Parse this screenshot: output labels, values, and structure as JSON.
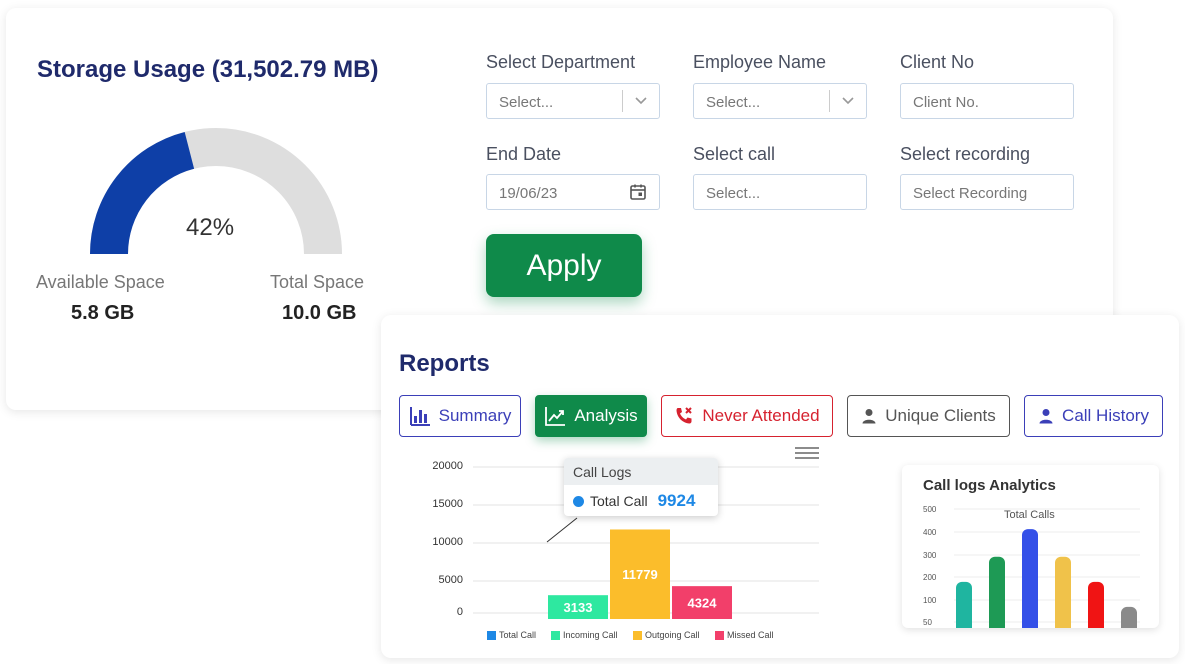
{
  "storage": {
    "title": "Storage Usage (31,502.79 MB)",
    "percent_label": "42%",
    "percent": 0.42,
    "available_label": "Available Space",
    "available_value": "5.8 GB",
    "total_label": "Total Space",
    "total_value": "10.0 GB",
    "used_color": "#0e3fa7",
    "track_color": "#dedede"
  },
  "filters": {
    "department": {
      "label": "Select Department",
      "placeholder": "Select..."
    },
    "employee": {
      "label": "Employee Name",
      "placeholder": "Select..."
    },
    "client": {
      "label": "Client No",
      "placeholder": "Client No."
    },
    "end_date": {
      "label": "End Date",
      "value": "19/06/23"
    },
    "call": {
      "label": "Select call",
      "placeholder": "Select..."
    },
    "recording": {
      "label": "Select recording",
      "placeholder": "Select Recording"
    },
    "apply_label": "Apply"
  },
  "reports": {
    "title": "Reports",
    "tabs": [
      {
        "label": "Summary",
        "icon": "bar-chart-icon"
      },
      {
        "label": "Analysis",
        "icon": "trend-icon"
      },
      {
        "label": "Never Attended",
        "icon": "missed-call-icon"
      },
      {
        "label": "Unique Clients",
        "icon": "user-icon"
      },
      {
        "label": "Call History",
        "icon": "user-icon"
      }
    ]
  },
  "chart_data": [
    {
      "type": "bar",
      "y_ticks": [
        "20000",
        "15000",
        "10000",
        "5000",
        "0"
      ],
      "ylim": [
        0,
        20000
      ],
      "series": [
        {
          "name": "Total Call",
          "value": 9924,
          "color": "#1e88e5"
        },
        {
          "name": "Incoming Call",
          "value": 3133,
          "color": "#2ee8a0"
        },
        {
          "name": "Outgoing Call",
          "value": 11779,
          "color": "#fbbd2b"
        },
        {
          "name": "Missed Call",
          "value": 4324,
          "color": "#f23f6a"
        }
      ],
      "tooltip": {
        "title": "Call Logs",
        "series": "Total Call",
        "value": "9924"
      }
    },
    {
      "type": "bar",
      "title": "Call logs Analytics",
      "subtitle": "Total Calls",
      "y_ticks": [
        "500",
        "400",
        "300",
        "200",
        "100",
        "50"
      ],
      "values": [
        210,
        310,
        420,
        310,
        210,
        110
      ],
      "colors": [
        "#1fb5a0",
        "#1e9a55",
        "#3450e8",
        "#f0c24a",
        "#f01414",
        "#8a8a8a"
      ]
    }
  ]
}
